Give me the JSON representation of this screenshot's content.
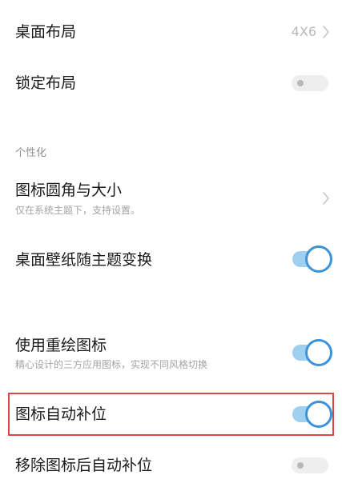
{
  "settings": {
    "desktop_layout": {
      "label": "桌面布局",
      "value": "4X6"
    },
    "lock_layout": {
      "label": "锁定布局",
      "enabled": false
    },
    "section_personalization": "个性化",
    "icon_corner_size": {
      "label": "图标圆角与大小",
      "subtitle": "仅在系统主题下，支持设置。"
    },
    "wallpaper_follow_theme": {
      "label": "桌面壁纸随主题变换",
      "enabled": true
    },
    "redraw_icons": {
      "label": "使用重绘图标",
      "subtitle": "精心设计的三方应用图标，实现不同风格切换",
      "enabled": true
    },
    "icon_auto_fill": {
      "label": "图标自动补位",
      "enabled": true
    },
    "auto_fill_after_remove": {
      "label": "移除图标后自动补位",
      "enabled": false
    }
  },
  "colors": {
    "toggle_on_accent": "#3b93db",
    "toggle_on_track": "#9fd0ef",
    "highlight_border": "#d94848"
  }
}
